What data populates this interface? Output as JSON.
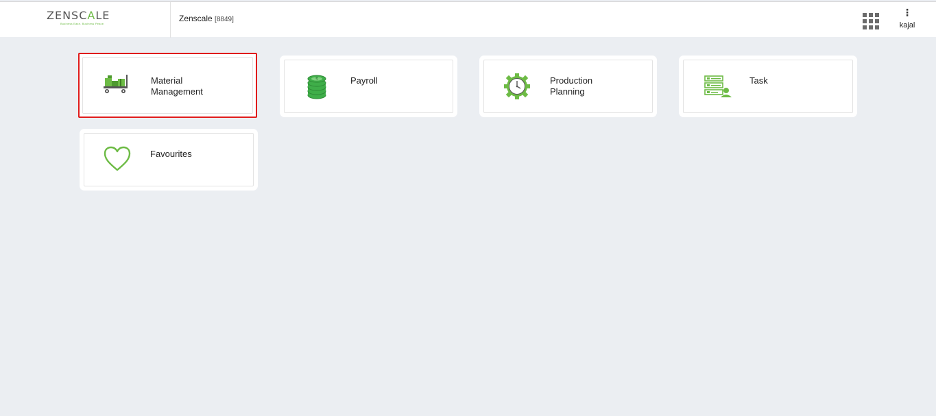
{
  "header": {
    "logo_prefix": "ZENSC",
    "logo_middle": "A",
    "logo_suffix": "LE",
    "logo_tagline": "Business Ease. Business Peace.",
    "company_name": "Zenscale",
    "company_code": "[8849]",
    "apps_icon": "grid-icon",
    "menu_icon": "kebab-icon",
    "username": "kajal"
  },
  "modules": [
    {
      "label_line1": "Material",
      "label_line2": "Management",
      "icon": "cart-icon",
      "selected": true
    },
    {
      "label_line1": "Payroll",
      "label_line2": "",
      "icon": "coins-icon",
      "selected": false
    },
    {
      "label_line1": "Production",
      "label_line2": "Planning",
      "icon": "gear-clock-icon",
      "selected": false
    },
    {
      "label_line1": "Task",
      "label_line2": "",
      "icon": "task-list-icon",
      "selected": false
    },
    {
      "label_line1": "Favourites",
      "label_line2": "",
      "icon": "heart-icon",
      "selected": false
    }
  ],
  "colors": {
    "accent_green": "#6dbb45",
    "selection_red": "#e01b1b",
    "background": "#ebeef2"
  }
}
